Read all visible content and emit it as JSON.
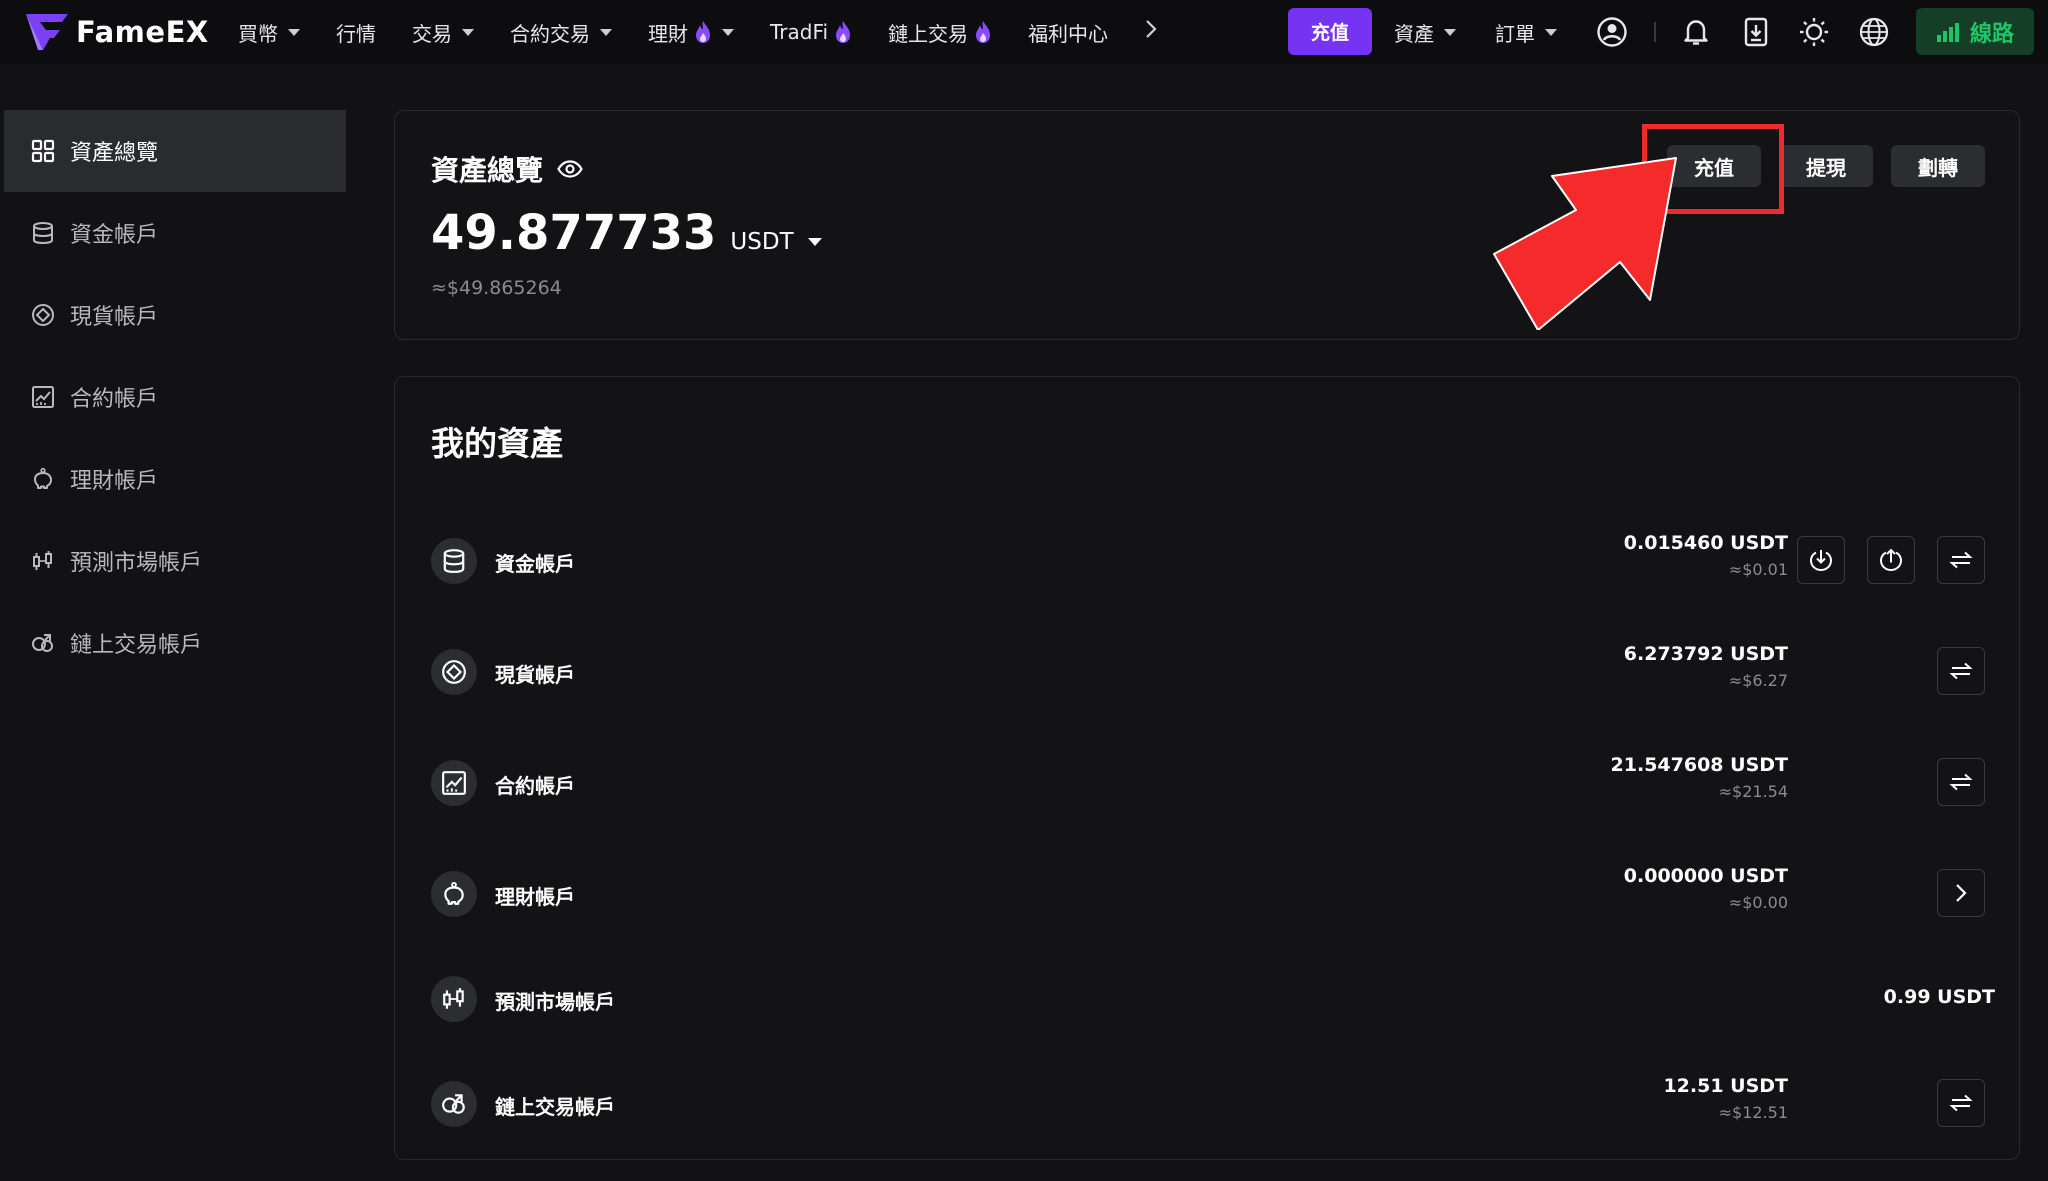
{
  "brand": {
    "name": "FameEX",
    "accent": "#7434f2"
  },
  "nav": {
    "items": [
      {
        "label": "買幣",
        "dropdown": true,
        "flame": false
      },
      {
        "label": "行情",
        "dropdown": false,
        "flame": false
      },
      {
        "label": "交易",
        "dropdown": true,
        "flame": false
      },
      {
        "label": "合約交易",
        "dropdown": true,
        "flame": false
      },
      {
        "label": "理財",
        "dropdown": true,
        "flame": true
      },
      {
        "label": "TradFi",
        "dropdown": false,
        "flame": true
      },
      {
        "label": "鏈上交易",
        "dropdown": false,
        "flame": true
      },
      {
        "label": "福利中心",
        "dropdown": false,
        "flame": false
      }
    ],
    "more_icon": "chevron-right-icon",
    "deposit_label": "充值",
    "assets_menu": "資產",
    "orders_menu": "訂單",
    "line_label": "線路",
    "line_color": "#21c26a"
  },
  "sidebar": {
    "items": [
      {
        "label": "資產總覽",
        "icon": "grid-icon",
        "active": true
      },
      {
        "label": "資金帳戶",
        "icon": "database-icon",
        "active": false
      },
      {
        "label": "現貨帳戶",
        "icon": "spot-icon",
        "active": false
      },
      {
        "label": "合約帳戶",
        "icon": "chart-icon",
        "active": false
      },
      {
        "label": "理財帳戶",
        "icon": "piggy-icon",
        "active": false
      },
      {
        "label": "預測市場帳戶",
        "icon": "candles-icon",
        "active": false
      },
      {
        "label": "鏈上交易帳戶",
        "icon": "onchain-icon",
        "active": false
      }
    ]
  },
  "overview": {
    "title": "資產總覽",
    "amount": "49.877733",
    "unit": "USDT",
    "approx": "≈$49.865264",
    "actions": {
      "deposit": "充值",
      "withdraw": "提現",
      "transfer": "劃轉"
    },
    "highlight_color": "#ee2b2b"
  },
  "assets": {
    "title": "我的資產",
    "rows": [
      {
        "name": "資金帳戶",
        "icon": "database-icon",
        "amount": "0.015460 USDT",
        "usd": "≈$0.01",
        "buttons": [
          "deposit-icon",
          "withdraw-icon",
          "transfer-icon"
        ]
      },
      {
        "name": "現貨帳戶",
        "icon": "spot-icon",
        "amount": "6.273792 USDT",
        "usd": "≈$6.27",
        "buttons": [
          "transfer-icon"
        ]
      },
      {
        "name": "合約帳戶",
        "icon": "chart-icon",
        "amount": "21.547608 USDT",
        "usd": "≈$21.54",
        "buttons": [
          "transfer-icon"
        ]
      },
      {
        "name": "理財帳戶",
        "icon": "piggy-icon",
        "amount": "0.000000 USDT",
        "usd": "≈$0.00",
        "buttons": [
          "chevron-right-icon"
        ]
      },
      {
        "name": "預測市場帳戶",
        "icon": "candles-icon",
        "amount": "0.99 USDT",
        "usd": "",
        "buttons": []
      },
      {
        "name": "鏈上交易帳戶",
        "icon": "onchain-icon",
        "amount": "12.51 USDT",
        "usd": "≈$12.51",
        "buttons": [
          "transfer-icon"
        ]
      }
    ]
  }
}
